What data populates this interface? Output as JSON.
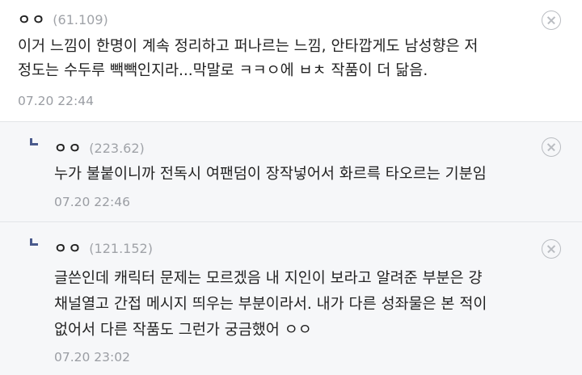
{
  "comments": [
    {
      "nickname": "ㅇㅇ",
      "ip": "(61.109)",
      "lines": [
        "이거 느낌이 한명이 계속 정리하고 퍼나르는 느낌, 안타깝게도 남성향은 저",
        "정도는 수두루 빽빽인지라...막말로 ㅋㅋㅇ에 ㅂㅊ 작품이 더 닮음."
      ],
      "date": "07.20 22:44",
      "is_reply": false,
      "delete_icon": "close-circle-icon"
    },
    {
      "nickname": "ㅇㅇ",
      "ip": "(223.62)",
      "lines": [
        "누가 불붙이니까 전독시 여팬덤이 장작넣어서 화르륵 타오르는 기분임"
      ],
      "date": "07.20 22:46",
      "is_reply": true,
      "delete_icon": "close-circle-icon"
    },
    {
      "nickname": "ㅇㅇ",
      "ip": "(121.152)",
      "lines": [
        "글쓴인데 캐릭터 문제는 모르겠음 내 지인이 보라고 알려준 부분은 걍",
        "채널열고 간접 메시지 띄우는 부분이라서. 내가 다른 성좌물은 본 적이",
        "없어서 다른 작품도 그런가 궁금했어 ㅇㅇ"
      ],
      "date": "07.20 23:02",
      "is_reply": true,
      "delete_icon": "close-circle-icon"
    }
  ],
  "colors": {
    "reply_background": "#f6f7f9",
    "reply_mark": "#4a5a8c",
    "meta_text": "#9a9da3",
    "divider": "#e3e5e8"
  }
}
